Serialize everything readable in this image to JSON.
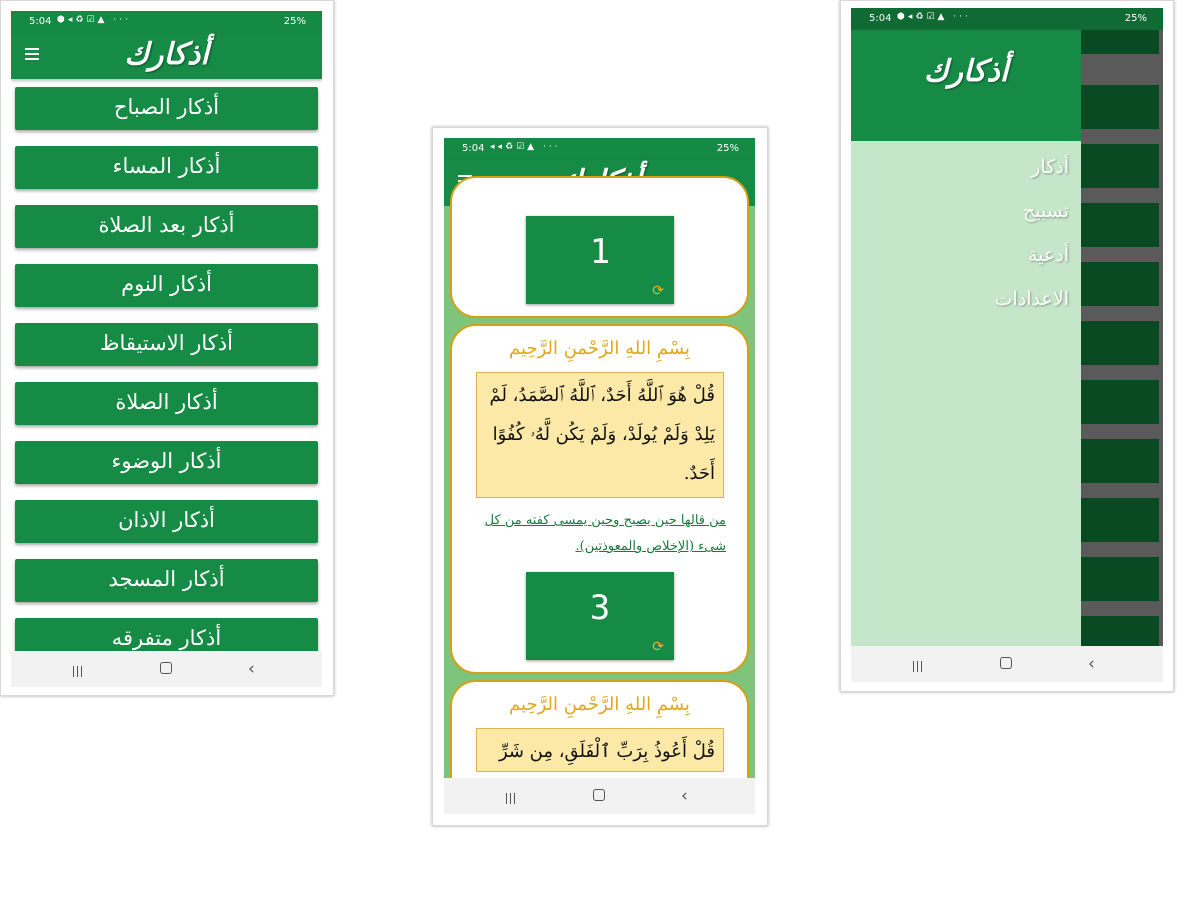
{
  "status_bar": {
    "time": "5:04",
    "battery": "25%"
  },
  "app": {
    "title": "أذكارك"
  },
  "menu": {
    "items": [
      "أذكار الصباح",
      "أذكار المساء",
      "أذكار بعد الصلاة",
      "أذكار النوم",
      "أذكار الاستيقاظ",
      "أذكار الصلاة",
      "أذكار الوضوء",
      "أذكار الاذان",
      "أذكار المسجد",
      "أذكار متفرقه"
    ]
  },
  "zikr_screen": {
    "top_counter": "1",
    "basmala": "بِسْمِ اللهِ الرَّحْمنِ الرَّحِيم",
    "card1": {
      "verse": "قُلْ هُوَ ٱللَّهُ أَحَدٌ، ٱللَّهُ ٱلصَّمَدُ، لَمْ يَلِدْ وَلَمْ يُولَدْ، وَلَمْ يَكُن لَّهُۥ كُفُوًا أَحَدٌ.",
      "note": "من قالها حين يصبح وحين يمسى كفته من كل شىء (الإخلاص والمعوذتين).",
      "counter": "3"
    },
    "card2": {
      "verse": "قُلْ أَعُوذُ بِرَبِّ ٱلْفَلَقِ، مِن شَرِّ"
    }
  },
  "drawer": {
    "items": [
      "أذكار",
      "تسبيح",
      "أدعية",
      "الاعدادات"
    ]
  },
  "colors": {
    "primary_green": "#168b46",
    "card_border": "#d4a017",
    "verse_bg": "#fce9a8",
    "drawer_bg": "#c6e6c9"
  }
}
